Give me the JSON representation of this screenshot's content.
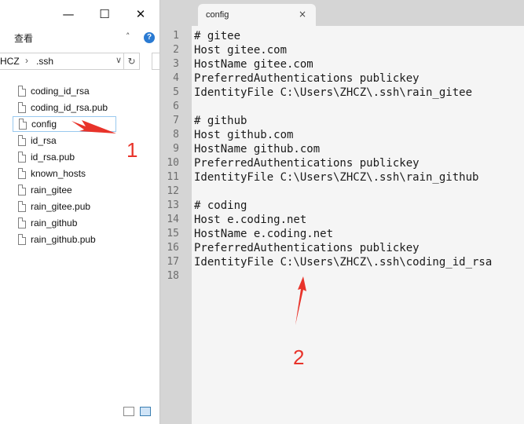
{
  "explorer": {
    "window_controls": {
      "minimize": "—",
      "maximize": "☐",
      "close": "✕"
    },
    "menu_view_label": "查看",
    "collapse_ribbon_icon": "chevron-up",
    "help_label": "?",
    "address": {
      "segment_1": "HCZ",
      "separator": "›",
      "segment_2": ".ssh",
      "dropdown": "∨",
      "refresh": "↻"
    },
    "files": [
      {
        "name": "coding_id_rsa"
      },
      {
        "name": "coding_id_rsa.pub"
      },
      {
        "name": "config"
      },
      {
        "name": "id_rsa"
      },
      {
        "name": "id_rsa.pub"
      },
      {
        "name": "known_hosts"
      },
      {
        "name": "rain_gitee"
      },
      {
        "name": "rain_gitee.pub"
      },
      {
        "name": "rain_github"
      },
      {
        "name": "rain_github.pub"
      }
    ],
    "selected_file": "config"
  },
  "editor": {
    "tab": {
      "label": "config",
      "close": "×"
    },
    "lines": [
      {
        "num": "1",
        "text": "# gitee"
      },
      {
        "num": "2",
        "text": "Host gitee.com"
      },
      {
        "num": "3",
        "text": "HostName gitee.com"
      },
      {
        "num": "4",
        "text": "PreferredAuthentications publickey"
      },
      {
        "num": "5",
        "text": "IdentityFile C:\\Users\\ZHCZ\\.ssh\\rain_gitee"
      },
      {
        "num": "6",
        "text": ""
      },
      {
        "num": "7",
        "text": "# github"
      },
      {
        "num": "8",
        "text": "Host github.com"
      },
      {
        "num": "9",
        "text": "HostName github.com"
      },
      {
        "num": "10",
        "text": "PreferredAuthentications publickey"
      },
      {
        "num": "11",
        "text": "IdentityFile C:\\Users\\ZHCZ\\.ssh\\rain_github"
      },
      {
        "num": "12",
        "text": ""
      },
      {
        "num": "13",
        "text": "# coding"
      },
      {
        "num": "14",
        "text": "Host e.coding.net"
      },
      {
        "num": "15",
        "text": "HostName e.coding.net"
      },
      {
        "num": "16",
        "text": "PreferredAuthentications publickey"
      },
      {
        "num": "17",
        "text": "IdentityFile C:\\Users\\ZHCZ\\.ssh\\coding_id_rsa"
      },
      {
        "num": "18",
        "text": ""
      }
    ]
  },
  "annotations": {
    "marker_1": "1",
    "marker_2": "2",
    "color": "#e8332a"
  }
}
